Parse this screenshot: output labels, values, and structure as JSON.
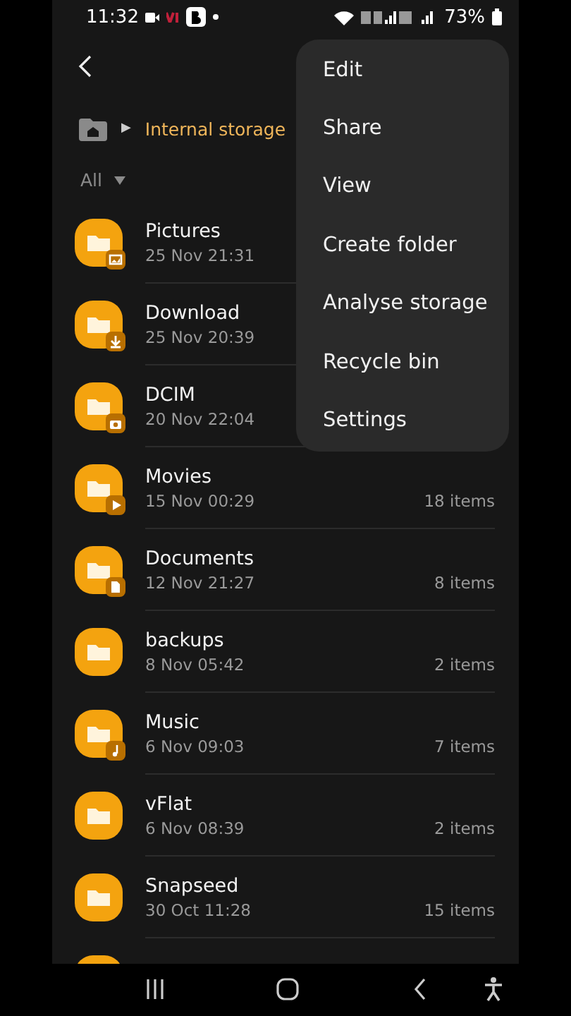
{
  "status_bar": {
    "time": "11:32",
    "battery": "73%"
  },
  "breadcrumb": {
    "separator": "▶",
    "location": "Internal storage"
  },
  "filter": {
    "label": "All"
  },
  "folders": [
    {
      "name": "Pictures",
      "date": "25 Nov 21:31",
      "kind": "image"
    },
    {
      "name": "Download",
      "date": "25 Nov 20:39",
      "kind": "download"
    },
    {
      "name": "DCIM",
      "date": "20 Nov 22:04",
      "kind": "camera"
    },
    {
      "name": "Movies",
      "date": "15 Nov 00:29",
      "count": "18 items",
      "kind": "play"
    },
    {
      "name": "Documents",
      "date": "12 Nov 21:27",
      "count": "8 items",
      "kind": "document"
    },
    {
      "name": "backups",
      "date": "8 Nov 05:42",
      "count": "2 items",
      "kind": "plain"
    },
    {
      "name": "Music",
      "date": "6 Nov 09:03",
      "count": "7 items",
      "kind": "music"
    },
    {
      "name": "vFlat",
      "date": "6 Nov 08:39",
      "count": "2 items",
      "kind": "plain"
    },
    {
      "name": "Snapseed",
      "date": "30 Oct 11:28",
      "count": "15 items",
      "kind": "plain"
    }
  ],
  "menu": [
    "Edit",
    "Share",
    "View",
    "Create folder",
    "Analyse storage",
    "Recycle bin",
    "Settings"
  ]
}
